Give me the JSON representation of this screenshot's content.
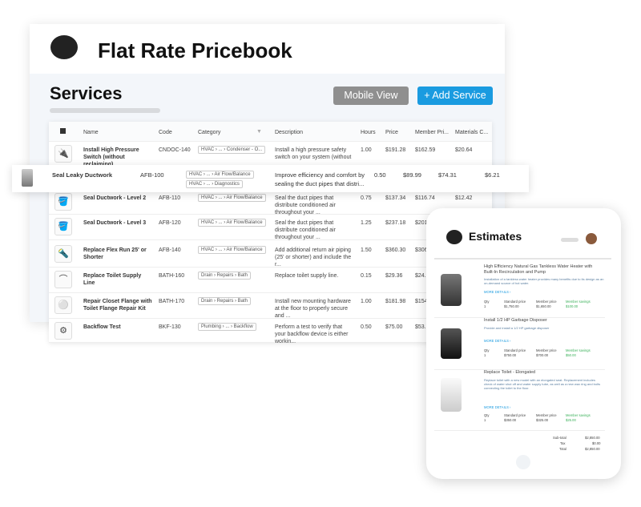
{
  "app": {
    "title": "Flat Rate Pricebook",
    "section": "Services",
    "mobile_view": "Mobile View",
    "add_service": "+ Add Service"
  },
  "table": {
    "headers": [
      "Name",
      "Code",
      "Category",
      "Description",
      "Hours",
      "Price",
      "Member Pri...",
      "Materials C..."
    ],
    "rows": [
      {
        "name": "Install High Pressure Switch (without reclaiming)",
        "code": "CNDOC-140",
        "cat": "HVAC › ... › Condenser - O...",
        "desc": "Install a high pressure safety switch on your system (without ...",
        "hours": "1.00",
        "price": "$191.28",
        "member": "$162.59",
        "mat": "$20.64",
        "icon": "🔌"
      },
      {
        "name": "Seal Ductwork - Level 2",
        "code": "AFB-110",
        "cat": "HVAC › ... › Air Flow/Balance",
        "desc": "Seal the duct pipes that distribute conditioned air throughout your ...",
        "hours": "0.75",
        "price": "$137.34",
        "member": "$116.74",
        "mat": "$12.42",
        "icon": "🪣"
      },
      {
        "name": "Seal Ductwork - Level 3",
        "code": "AFB-120",
        "cat": "HVAC › ... › Air Flow/Balance",
        "desc": "Seal the duct pipes that distribute conditioned air throughout your ...",
        "hours": "1.25",
        "price": "$237.18",
        "member": "$201",
        "mat": "",
        "icon": "🪣"
      },
      {
        "name": "Replace Flex Run 25' or Shorter",
        "code": "AFB-140",
        "cat": "HVAC › ... › Air Flow/Balance",
        "desc": "Add additional return air piping (25' or shorter) and include the r...",
        "hours": "1.50",
        "price": "$360.30",
        "member": "$306",
        "mat": "",
        "icon": "🔦"
      },
      {
        "name": "Replace Toilet Supply Line",
        "code": "BATH-160",
        "cat": "Drain › Repairs › Bath",
        "desc": "Replace toilet supply line.",
        "hours": "0.15",
        "price": "$29.36",
        "member": "$24.9",
        "mat": "",
        "icon": "⌒"
      },
      {
        "name": "Repair Closet Flange with Toilet Flange Repair Kit",
        "code": "BATH-170",
        "cat": "Drain › Repairs › Bath",
        "desc": "Install new mounting hardware at the floor to properly secure and ...",
        "hours": "1.00",
        "price": "$181.98",
        "member": "$154",
        "mat": "",
        "icon": "⚪"
      },
      {
        "name": "Backflow Test",
        "code": "BKF-130",
        "cat": "Plumbing › ... › Backflow",
        "desc": "Perform a test to verify that your backflow device is either workin...",
        "hours": "0.50",
        "price": "$75.00",
        "member": "$53.7",
        "mat": "",
        "icon": "⚙"
      }
    ],
    "highlight": {
      "name": "Seal Leaky Ductwork",
      "code": "AFB-100",
      "cat1": "HVAC › ... › Air Flow/Balance",
      "cat2": "HVAC › ... › Diagnostics",
      "desc": "Improve efficiency and comfort by sealing the duct pipes that distri...",
      "hours": "0.50",
      "price": "$89.99",
      "member": "$74.31",
      "mat": "$6.21"
    }
  },
  "estimates": {
    "title": "Estimates",
    "labels": {
      "qty": "Qty",
      "std": "Standard price",
      "mem": "Member price",
      "sav": "Member savings",
      "more": "MORE DETAILS ›"
    },
    "items": [
      {
        "title": "High Efficiency Natural Gas Tankless Water Heater with Built-In Recirculation and Pump",
        "desc": "Installation of a tankless water heater provides many benefits due to its design as an on-demand source of hot water.",
        "qty": "1",
        "std": "$1,750.00",
        "mem": "$1,650.00",
        "sav": "$100.00"
      },
      {
        "title": "Install 1/2 HP Garbage Disposer",
        "desc": "Provide and install a 1/2 HP garbage disposer",
        "qty": "1",
        "std": "$750.00",
        "mem": "$700.00",
        "sav": "$50.00"
      },
      {
        "title": "Replace Toilet - Elongated",
        "desc": "Replace toilet with a new model with an elongated seat. Replacement includes check of water shut off and water supply tube, as well as a new wax ring and bolts connecting the toilet to the floor.",
        "qty": "1",
        "std": "$350.00",
        "mem": "$325.00",
        "sav": "$25.00"
      }
    ],
    "totals": {
      "subtotal_label": "Sub-total",
      "subtotal": "$2,850.00",
      "tax_label": "Tax",
      "tax": "$0.00",
      "total_label": "Total",
      "total": "$2,850.00"
    }
  },
  "colors": {
    "accent": "#1a9be0",
    "gray_button": "#8f8f8f",
    "savings": "#3bb15a"
  }
}
